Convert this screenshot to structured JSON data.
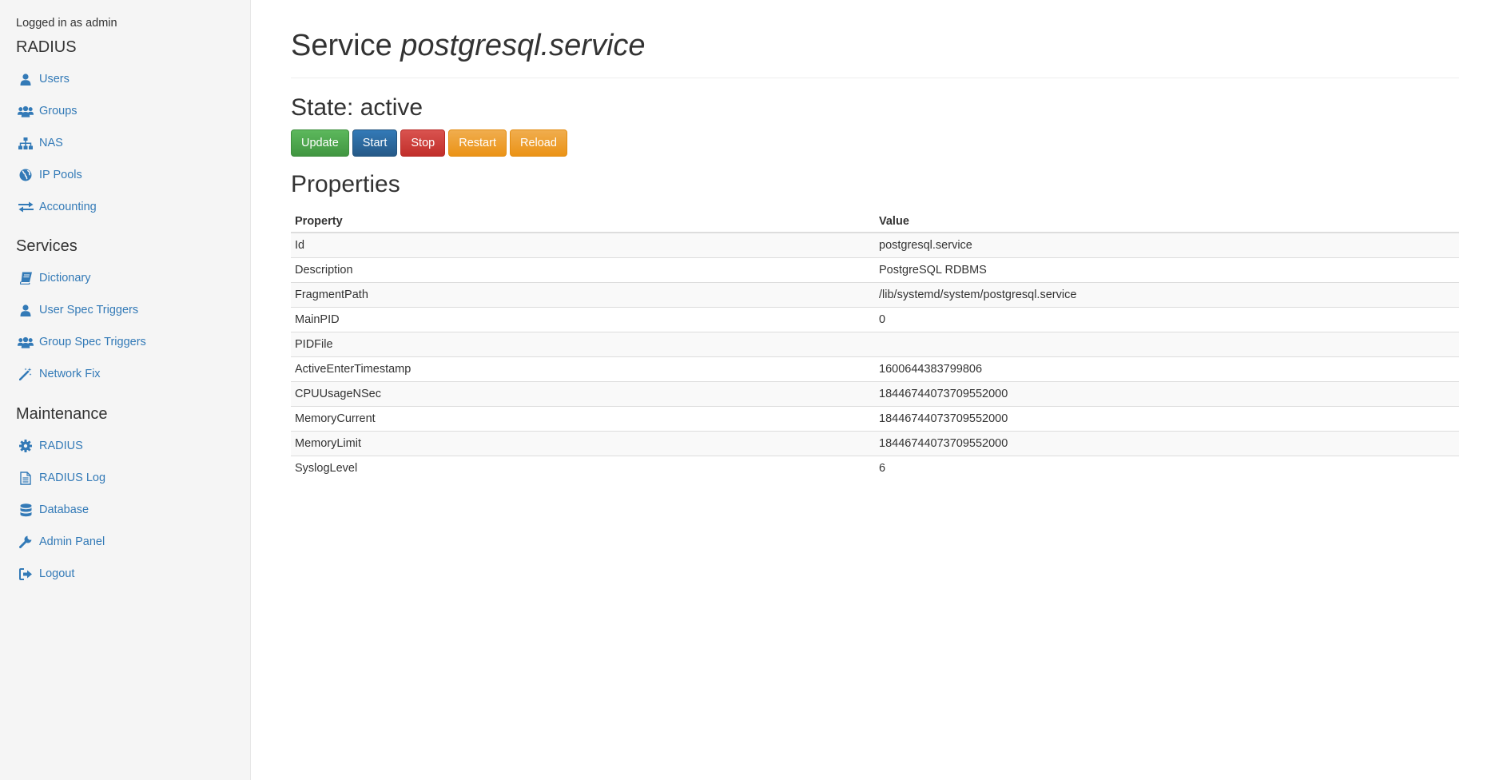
{
  "sidebar": {
    "logged_in": "Logged in as admin",
    "sections": [
      {
        "title": "RADIUS",
        "items": [
          {
            "label": "Users",
            "icon": "user-icon"
          },
          {
            "label": "Groups",
            "icon": "users-icon"
          },
          {
            "label": "NAS",
            "icon": "sitemap-icon"
          },
          {
            "label": "IP Pools",
            "icon": "globe-icon"
          },
          {
            "label": "Accounting",
            "icon": "exchange-icon"
          }
        ]
      },
      {
        "title": "Services",
        "items": [
          {
            "label": "Dictionary",
            "icon": "book-icon"
          },
          {
            "label": "User Spec Triggers",
            "icon": "user-icon"
          },
          {
            "label": "Group Spec Triggers",
            "icon": "users-icon"
          },
          {
            "label": "Network Fix",
            "icon": "magic-wand-icon"
          }
        ]
      },
      {
        "title": "Maintenance",
        "items": [
          {
            "label": "RADIUS",
            "icon": "gear-icon"
          },
          {
            "label": "RADIUS Log",
            "icon": "file-text-icon"
          },
          {
            "label": "Database",
            "icon": "database-icon"
          },
          {
            "label": "Admin Panel",
            "icon": "wrench-icon"
          },
          {
            "label": "Logout",
            "icon": "sign-out-icon"
          }
        ]
      }
    ]
  },
  "main": {
    "title_prefix": "Service",
    "title_service": "postgresql.service",
    "state_label": "State: active",
    "buttons": {
      "update": "Update",
      "start": "Start",
      "stop": "Stop",
      "restart": "Restart",
      "reload": "Reload"
    },
    "properties_title": "Properties",
    "table": {
      "headers": [
        "Property",
        "Value"
      ],
      "rows": [
        [
          "Id",
          "postgresql.service"
        ],
        [
          "Description",
          "PostgreSQL RDBMS"
        ],
        [
          "FragmentPath",
          "/lib/systemd/system/postgresql.service"
        ],
        [
          "MainPID",
          "0"
        ],
        [
          "PIDFile",
          ""
        ],
        [
          "ActiveEnterTimestamp",
          "1600644383799806"
        ],
        [
          "CPUUsageNSec",
          "18446744073709552000"
        ],
        [
          "MemoryCurrent",
          "18446744073709552000"
        ],
        [
          "MemoryLimit",
          "18446744073709552000"
        ],
        [
          "SyslogLevel",
          "6"
        ]
      ]
    }
  },
  "colors": {
    "link": "#337ab7",
    "sidebar_bg": "#f5f5f5",
    "success": "#5cb85c",
    "primary": "#337ab7",
    "danger": "#d9534f",
    "warning": "#f0ad4e"
  }
}
